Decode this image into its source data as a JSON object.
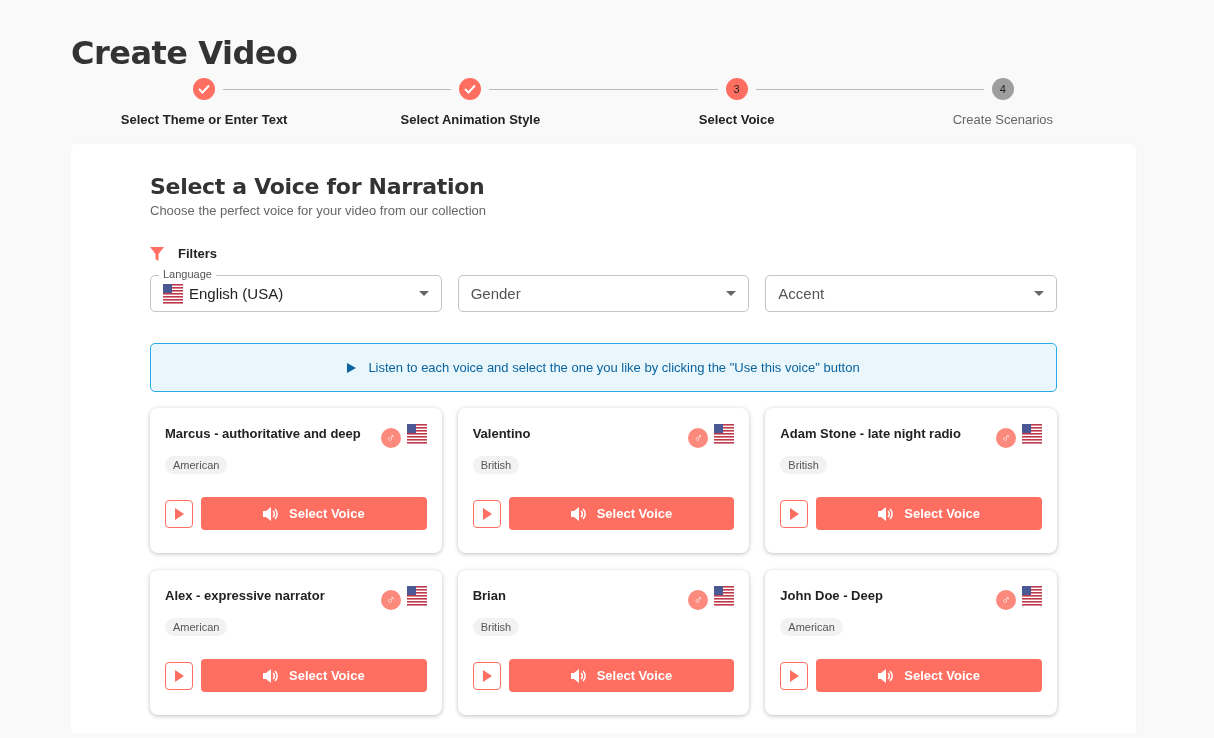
{
  "page_title": "Create Video",
  "steps": [
    {
      "label": "Select Theme or Enter Text",
      "completed": true,
      "current": false
    },
    {
      "label": "Select Animation Style",
      "completed": true,
      "current": false
    },
    {
      "label": "Select Voice",
      "completed": false,
      "current": true,
      "number": "3"
    },
    {
      "label": "Create Scenarios",
      "completed": false,
      "current": false,
      "number": "4"
    }
  ],
  "panel": {
    "title": "Select a Voice for Narration",
    "subtitle": "Choose the perfect voice for your video from our collection",
    "filters_label": "Filters",
    "filters": [
      {
        "label": "Language",
        "value": "English (USA)"
      },
      {
        "placeholder": "Gender"
      },
      {
        "placeholder": "Accent"
      }
    ],
    "info": "Listen to each voice and select the one you like by clicking the \"Use this voice\" button",
    "voices": [
      {
        "name": "Marcus - authoritative and deep",
        "gender_symbol": "♂",
        "accent": "American",
        "button": "Select Voice"
      },
      {
        "name": "Valentino",
        "gender_symbol": "♂",
        "accent": "British",
        "button": "Select Voice"
      },
      {
        "name": "Adam Stone - late night radio",
        "gender_symbol": "♂",
        "accent": "British",
        "button": "Select Voice"
      },
      {
        "name": "Alex - expressive narrator",
        "gender_symbol": "♂",
        "accent": "American",
        "button": "Select Voice"
      },
      {
        "name": "Brian",
        "gender_symbol": "♂",
        "accent": "British",
        "button": "Select Voice"
      },
      {
        "name": "John Doe - Deep",
        "gender_symbol": "♂",
        "accent": "American",
        "button": "Select Voice"
      }
    ]
  }
}
